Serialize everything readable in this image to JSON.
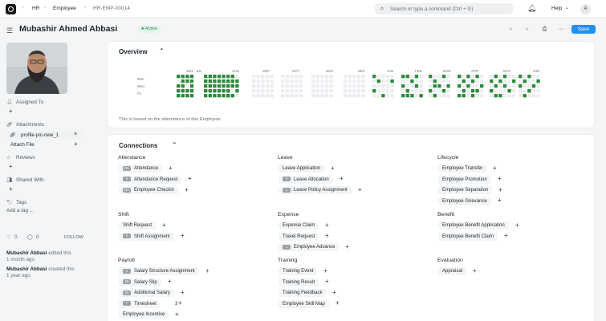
{
  "breadcrumbs": [
    "HR",
    "Employee",
    "HR-EMP-00014"
  ],
  "search": {
    "placeholder": "Search or type a command (Ctrl + G)"
  },
  "help": "Help",
  "avatar_initial": "A",
  "employee": {
    "name": "Mubashir Ahmed Abbasi",
    "status": "Active"
  },
  "toolbar": {
    "save": "Save"
  },
  "sidebar": {
    "assigned_to": "Assigned To",
    "attachments": "Attachments",
    "attachment_file": "profile-pic-new_1",
    "attach_file": "Attach File",
    "reviews": "Reviews",
    "shared_with": "Shared With",
    "tags": "Tags",
    "add_tag": "Add a tag ...",
    "likes": "0",
    "comments": "0",
    "follow": "FOLLOW",
    "activity": [
      {
        "user": "Mubashir Abbasi",
        "action": "edited this",
        "time": "1 month ago"
      },
      {
        "user": "Mubashir Abbasi",
        "action": "created this",
        "time": "1 year ago"
      }
    ]
  },
  "overview": {
    "title": "Overview",
    "months": [
      "JUN",
      "JUL",
      "AUG",
      "SEP",
      "OCT",
      "NOV",
      "DEC",
      "JAN",
      "FEB",
      "MAR",
      "APR",
      "MAY",
      "JUN"
    ],
    "days": [
      "Mon",
      "Wed",
      "Fri"
    ],
    "note": "This is based on the attendance of this Employee.",
    "colors": {
      "present": "#2e8b3c",
      "empty": "#ebedf0"
    }
  },
  "connections": {
    "title": "Connections",
    "groups": [
      {
        "title": "Attendance",
        "items": [
          {
            "label": "Attendance",
            "count": "20+"
          },
          {
            "label": "Attendance Request",
            "count": "5"
          },
          {
            "label": "Employee Checkin",
            "count": "20+"
          }
        ]
      },
      {
        "title": "Leave",
        "items": [
          {
            "label": "Leave Application",
            "count": ""
          },
          {
            "label": "Leave Allocation",
            "count": "3"
          },
          {
            "label": "Leave Policy Assignment",
            "count": "1"
          }
        ]
      },
      {
        "title": "Lifecycle",
        "items": [
          {
            "label": "Employee Transfer",
            "count": ""
          },
          {
            "label": "Employee Promotion",
            "count": ""
          },
          {
            "label": "Employee Separation",
            "count": ""
          },
          {
            "label": "Employee Grievance",
            "count": ""
          }
        ]
      },
      {
        "title": "Shift",
        "items": [
          {
            "label": "Shift Request",
            "count": ""
          },
          {
            "label": "Shift Assignment",
            "count": "2"
          }
        ]
      },
      {
        "title": "Expense",
        "items": [
          {
            "label": "Expense Claim",
            "count": ""
          },
          {
            "label": "Travel Request",
            "count": ""
          },
          {
            "label": "Employee Advance",
            "count": "1"
          }
        ]
      },
      {
        "title": "Benefit",
        "items": [
          {
            "label": "Employee Benefit Application",
            "count": ""
          },
          {
            "label": "Employee Benefit Claim",
            "count": ""
          }
        ]
      },
      {
        "title": "Payroll",
        "items": [
          {
            "label": "Salary Structure Assignment",
            "count": "4"
          },
          {
            "label": "Salary Slip",
            "count": "15"
          },
          {
            "label": "Additional Salary",
            "count": "11"
          },
          {
            "label": "Timesheet",
            "count": "7",
            "suffix": "3"
          },
          {
            "label": "Employee Incentive",
            "count": ""
          }
        ]
      },
      {
        "title": "Training",
        "items": [
          {
            "label": "Training Event",
            "count": ""
          },
          {
            "label": "Training Result",
            "count": ""
          },
          {
            "label": "Training Feedback",
            "count": ""
          },
          {
            "label": "Employee Skill Map",
            "count": ""
          }
        ]
      },
      {
        "title": "Evaluation",
        "items": [
          {
            "label": "Appraisal",
            "count": ""
          }
        ]
      }
    ]
  }
}
